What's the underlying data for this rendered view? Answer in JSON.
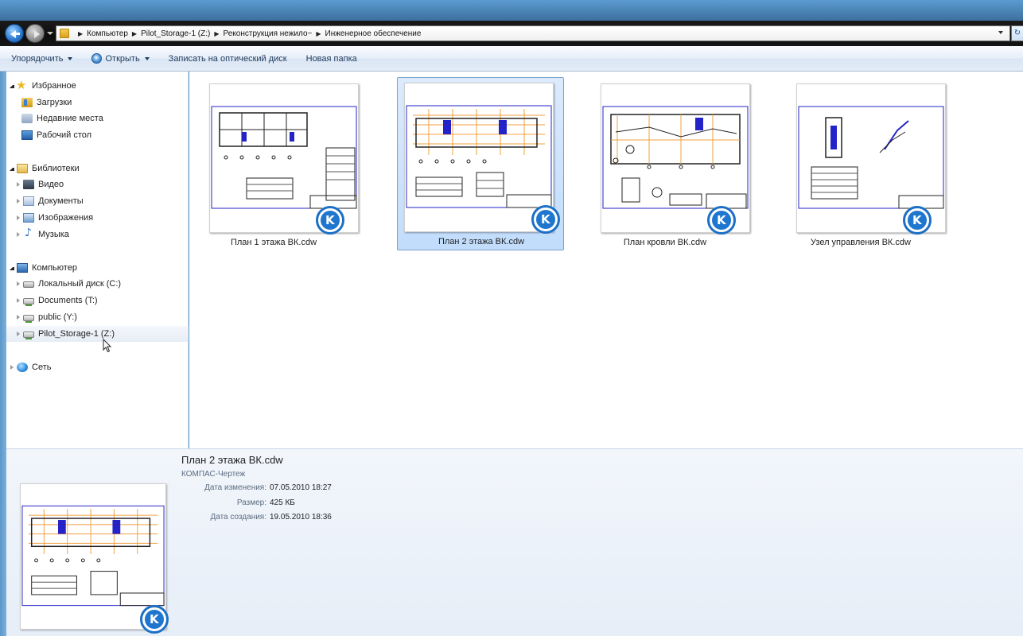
{
  "window": {
    "address_path": [
      "Компьютер",
      "Pilot_Storage-1 (Z:)",
      "Реконструкция нежило~",
      "Инженерное обеспечение"
    ]
  },
  "toolbar": {
    "organize_label": "Упорядочить",
    "open_label": "Открыть",
    "burn_label": "Записать на оптический диск",
    "new_folder_label": "Новая папка"
  },
  "nav": {
    "favorites": "Избранное",
    "downloads": "Загрузки",
    "recent_places": "Недавние места",
    "desktop": "Рабочий стол",
    "libraries": "Библиотеки",
    "video": "Видео",
    "documents": "Документы",
    "images": "Изображения",
    "music": "Музыка",
    "computer": "Компьютер",
    "local_disk": "Локальный диск (C:)",
    "documents_drive": "Documents (T:)",
    "public_drive": "public (Y:)",
    "pilot_storage": "Pilot_Storage-1 (Z:)",
    "network": "Сеть"
  },
  "files": [
    {
      "name": "План 1 этажа ВК.cdw",
      "selected": false
    },
    {
      "name": "План 2 этажа ВК.cdw",
      "selected": true
    },
    {
      "name": "План кровли ВК.cdw",
      "selected": false
    },
    {
      "name": "Узел управления ВК.cdw",
      "selected": false
    }
  ],
  "details": {
    "file_name": "План 2 этажа ВК.cdw",
    "file_type": "КОМПАС-Чертеж",
    "modified_label": "Дата изменения:",
    "modified_value": "07.05.2010 18:27",
    "size_label": "Размер:",
    "size_value": "425 КБ",
    "created_label": "Дата создания:",
    "created_value": "19.05.2010 18:36"
  },
  "colors": {
    "selection": "#c1dcfc",
    "selection_border": "#7da2ce",
    "kompas_blue": "#1f76cf",
    "drawing_frame": "#2323c8",
    "drawing_grid": "#f0a040"
  },
  "icons": {
    "back": "back-arrow-icon",
    "forward": "forward-arrow-icon",
    "file_overlay": "kompas-logo-icon"
  }
}
